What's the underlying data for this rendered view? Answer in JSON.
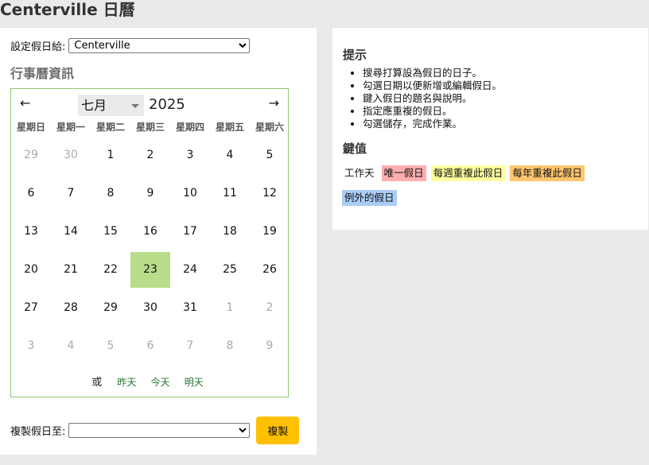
{
  "page": {
    "title": "Centerville 日曆"
  },
  "form": {
    "set_label": "設定假日給:",
    "library_selected": "Centerville",
    "copy_label": "複製假日至:",
    "copy_selected": "",
    "copy_button": "複製"
  },
  "calendar": {
    "section_title": "行事曆資訊",
    "prev_icon": "←",
    "next_icon": "→",
    "month": "七月",
    "year": "2025",
    "weekdays": [
      "星期日",
      "星期一",
      "星期二",
      "星期三",
      "星期四",
      "星期五",
      "星期六"
    ],
    "weeks": [
      [
        "29",
        "30",
        "1",
        "2",
        "3",
        "4",
        "5"
      ],
      [
        "6",
        "7",
        "8",
        "9",
        "10",
        "11",
        "12"
      ],
      [
        "13",
        "14",
        "15",
        "16",
        "17",
        "18",
        "19"
      ],
      [
        "20",
        "21",
        "22",
        "23",
        "24",
        "25",
        "26"
      ],
      [
        "27",
        "28",
        "29",
        "30",
        "31",
        "1",
        "2"
      ],
      [
        "3",
        "4",
        "5",
        "6",
        "7",
        "8",
        "9"
      ]
    ],
    "selected_day": "23",
    "footer": {
      "or": "或",
      "yesterday": "昨天",
      "today": "今天",
      "tomorrow": "明天"
    },
    "colors": {
      "selected": "#b8dd8a",
      "border": "#8fc86f"
    }
  },
  "help": {
    "title": "提示",
    "items": [
      "搜尋打算設為假日的日子。",
      "勾選日期以便新增或編輯假日。",
      "鍵入假日的題名與說明。",
      "指定應重複的假日。",
      "勾選儲存，完成作業。"
    ]
  },
  "keys": {
    "title": "鍵值",
    "working": "工作天",
    "unique": "唯一假日",
    "weekly": "每週重複此假日",
    "yearly": "每年重複此假日",
    "exception": "例外的假日",
    "colors": {
      "unique": "#ffaeae",
      "weekly": "#ffff9f",
      "yearly": "#ffc66f",
      "exception": "#a9cdf5",
      "copy_button": "#ffc000"
    }
  }
}
